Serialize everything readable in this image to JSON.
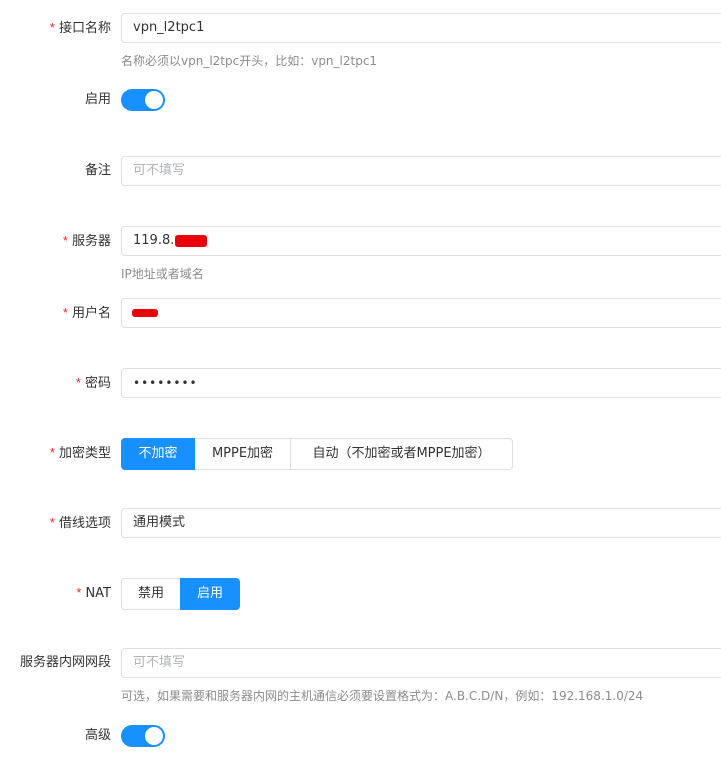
{
  "form": {
    "interface_name": {
      "label": "接口名称",
      "required": "*",
      "value": "vpn_l2tpc1",
      "hint": "名称必须以vpn_l2tpc开头，比如：vpn_l2tpc1"
    },
    "enable": {
      "label": "启用",
      "on": true
    },
    "remark": {
      "label": "备注",
      "placeholder": "可不填写"
    },
    "server": {
      "label": "服务器",
      "required": "*",
      "value": "119.8.",
      "hint": "IP地址或者域名"
    },
    "username": {
      "label": "用户名",
      "required": "*"
    },
    "password": {
      "label": "密码",
      "required": "*",
      "value": "••••••••"
    },
    "encryption": {
      "label": "加密类型",
      "required": "*",
      "options": [
        "不加密",
        "MPPE加密",
        "自动（不加密或者MPPE加密）"
      ],
      "selected": "不加密"
    },
    "line_option": {
      "label": "借线选项",
      "required": "*",
      "value": "通用模式"
    },
    "nat": {
      "label": "NAT",
      "required": "*",
      "options": [
        "禁用",
        "启用"
      ],
      "selected": "启用"
    },
    "server_lan": {
      "label": "服务器内网网段",
      "placeholder": "可不填写",
      "hint": "可选，如果需要和服务器内网的主机通信必须要设置格式为：A.B.C.D/N，例如：192.168.1.0/24"
    },
    "advanced": {
      "label": "高级",
      "on": true
    }
  },
  "colors": {
    "accent": "#1890ff",
    "required": "#f5222d",
    "border": "#dcdfe6",
    "hint": "#8c8c8c",
    "redaction": "#e8000b"
  }
}
